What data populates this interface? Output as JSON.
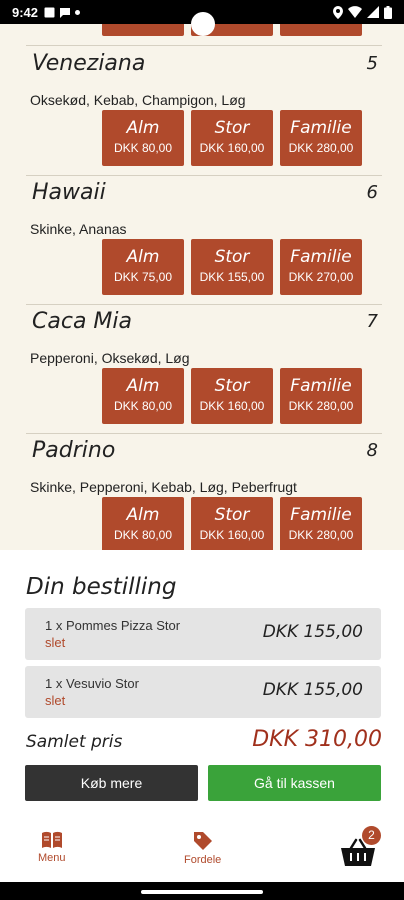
{
  "status_bar": {
    "time": "9:42"
  },
  "pizzas": [
    {
      "name": "Veneziana",
      "number": "5",
      "ingredients": "Oksekød, Kebab, Champigon, Løg",
      "sizes": [
        {
          "label": "Alm",
          "price": "DKK 80,00"
        },
        {
          "label": "Stor",
          "price": "DKK 160,00"
        },
        {
          "label": "Familie",
          "price": "DKK 280,00"
        }
      ]
    },
    {
      "name": "Hawaii",
      "number": "6",
      "ingredients": "Skinke, Ananas",
      "sizes": [
        {
          "label": "Alm",
          "price": "DKK 75,00"
        },
        {
          "label": "Stor",
          "price": "DKK 155,00"
        },
        {
          "label": "Familie",
          "price": "DKK 270,00"
        }
      ]
    },
    {
      "name": "Caca Mia",
      "number": "7",
      "ingredients": "Pepperoni, Oksekød, Løg",
      "sizes": [
        {
          "label": "Alm",
          "price": "DKK 80,00"
        },
        {
          "label": "Stor",
          "price": "DKK 160,00"
        },
        {
          "label": "Familie",
          "price": "DKK 280,00"
        }
      ]
    },
    {
      "name": "Padrino",
      "number": "8",
      "ingredients": "Skinke, Pepperoni, Kebab, Løg, Peberfrugt",
      "sizes": [
        {
          "label": "Alm",
          "price": "DKK 80,00"
        },
        {
          "label": "Stor",
          "price": "DKK 160,00"
        },
        {
          "label": "Familie",
          "price": "DKK 280,00"
        }
      ]
    }
  ],
  "order": {
    "title": "Din bestilling",
    "items": [
      {
        "name": "1 x Pommes Pizza Stor",
        "delete_label": "slet",
        "price": "DKK 155,00"
      },
      {
        "name": "1 x Vesuvio Stor",
        "delete_label": "slet",
        "price": "DKK 155,00"
      }
    ],
    "total_label": "Samlet pris",
    "total_value": "DKK 310,00",
    "buy_more_label": "Køb mere",
    "checkout_label": "Gå til kassen"
  },
  "bottom_nav": {
    "menu_label": "Menu",
    "benefits_label": "Fordele",
    "cart_count": "2",
    "icons": {
      "menu": "book-icon",
      "benefits": "tag-icon",
      "cart": "basket-icon"
    }
  },
  "colors": {
    "accent": "#b04a2c",
    "checkout": "#3aa33a",
    "buy_more": "#333333",
    "background": "#f8f4ea"
  }
}
